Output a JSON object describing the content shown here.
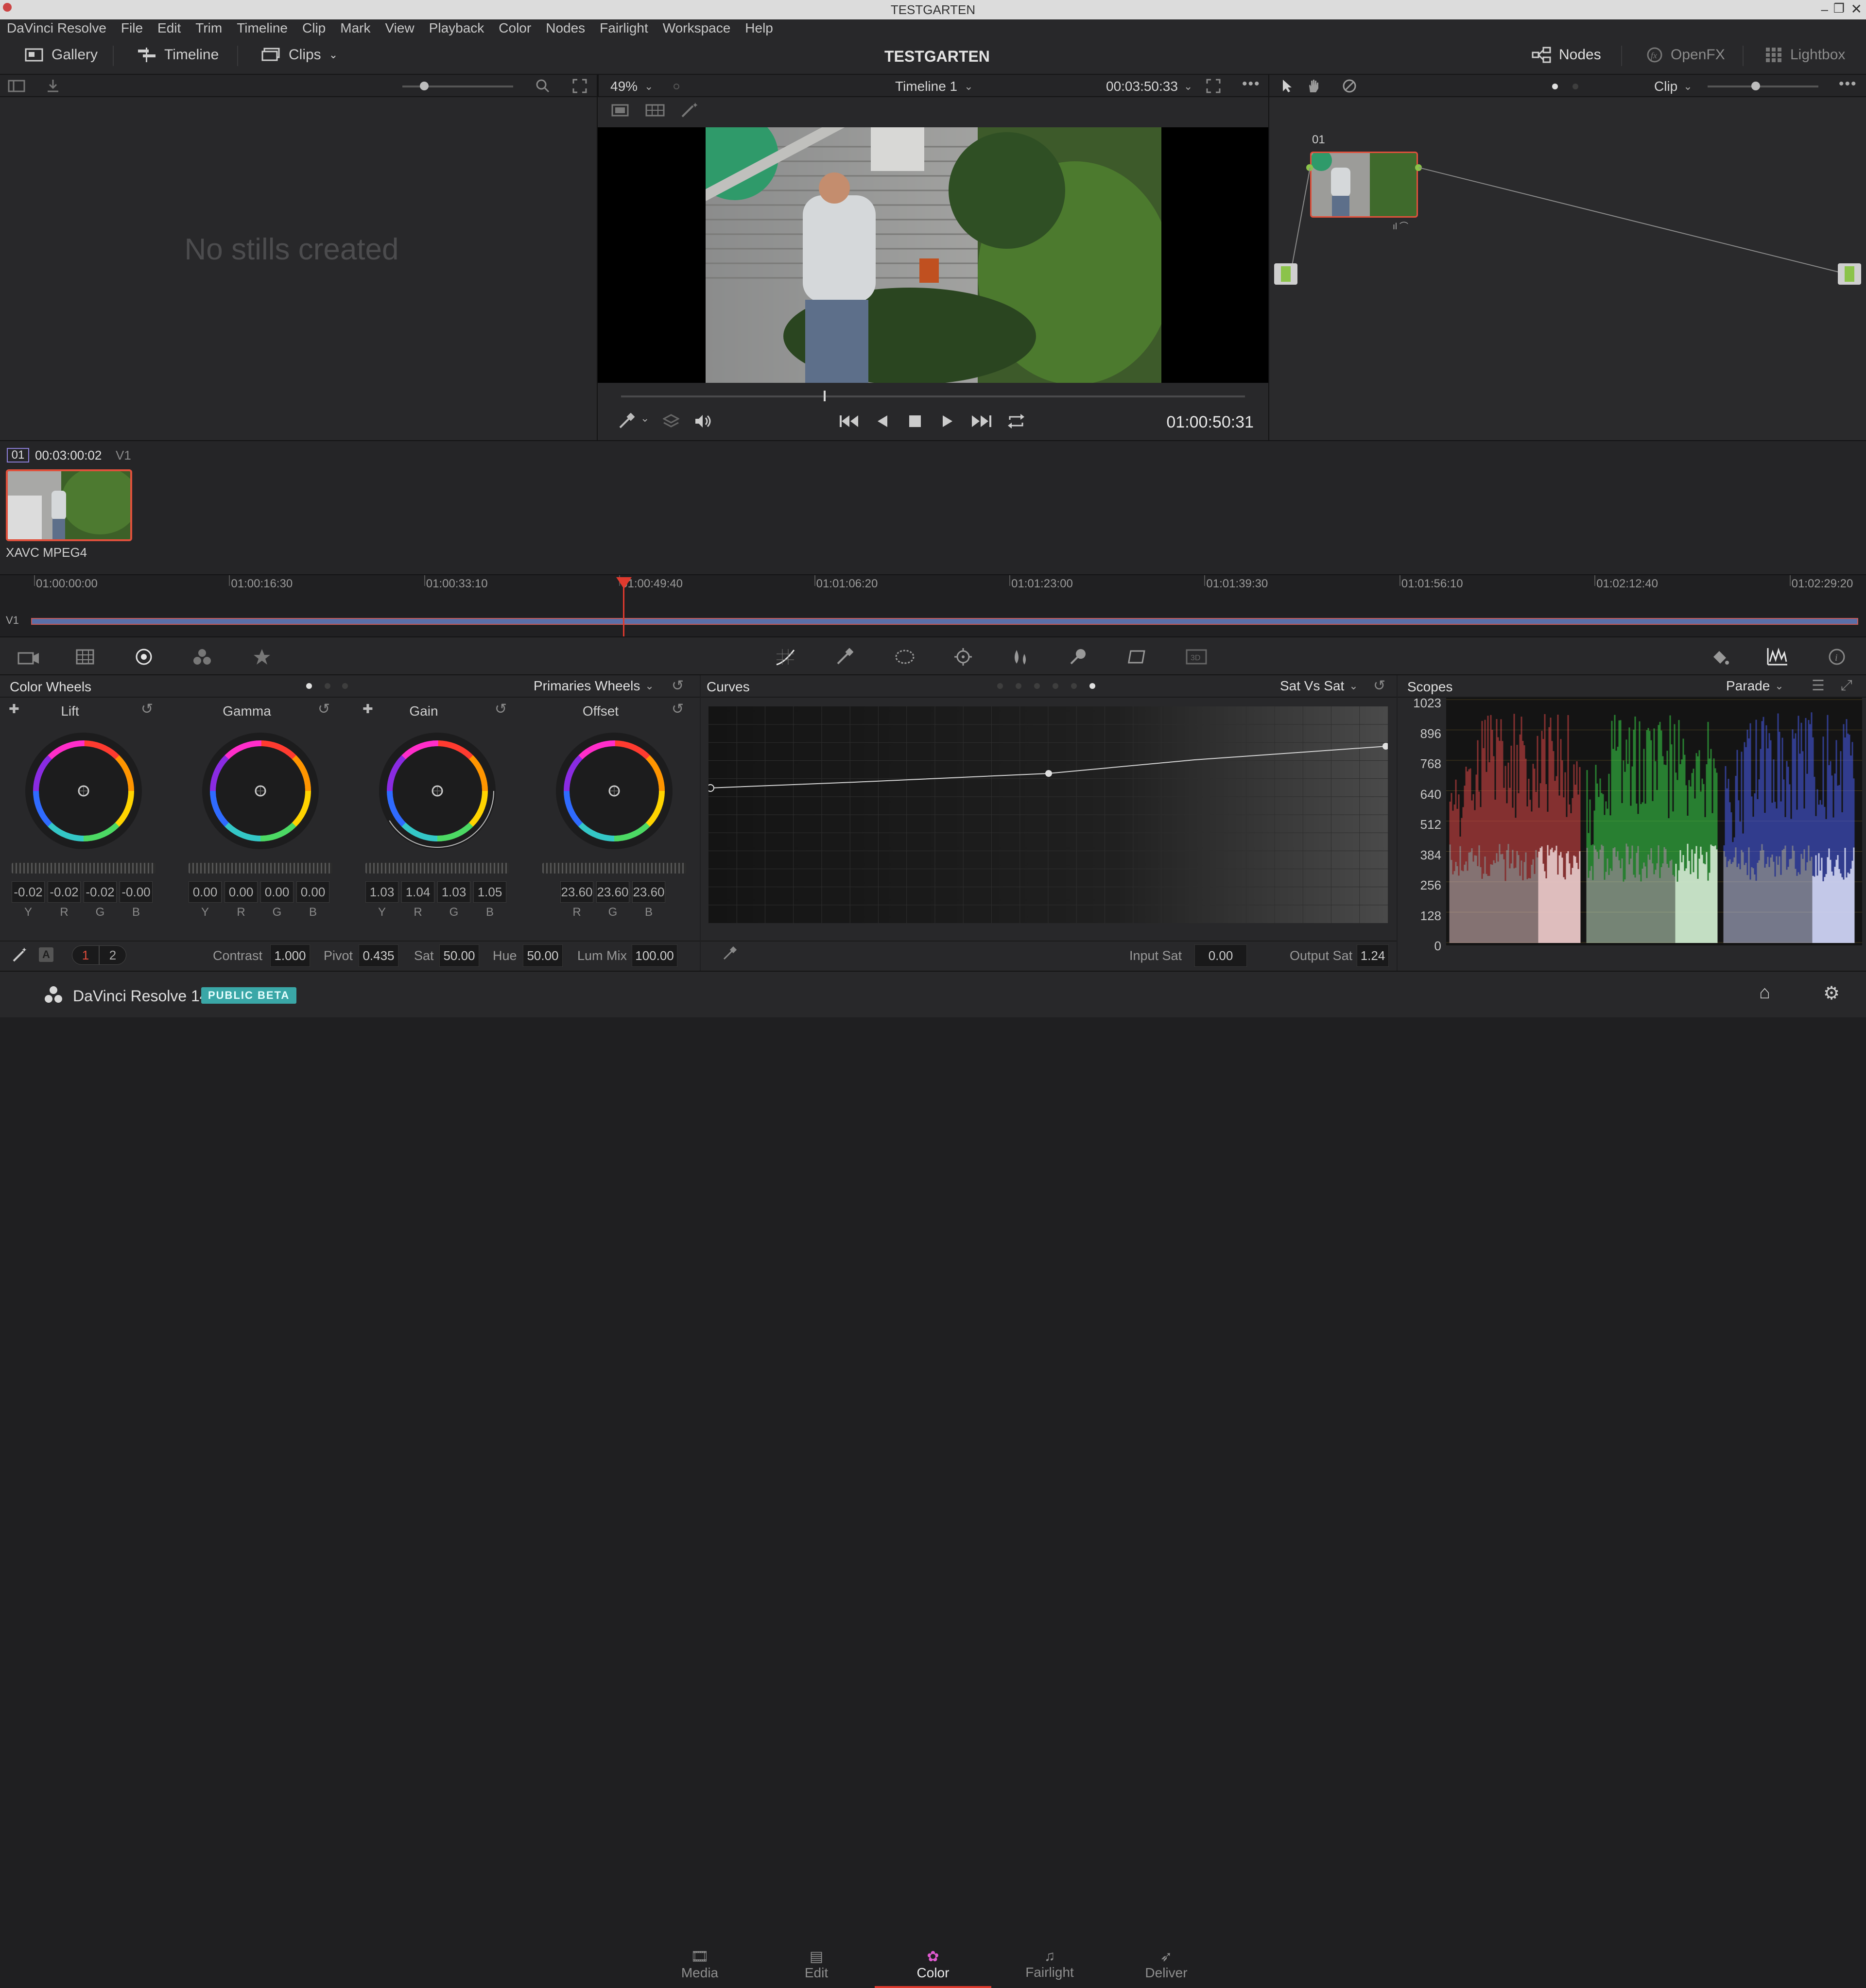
{
  "window": {
    "title": "TESTGARTEN"
  },
  "menu": [
    "DaVinci Resolve",
    "File",
    "Edit",
    "Trim",
    "Timeline",
    "Clip",
    "Mark",
    "View",
    "Playback",
    "Color",
    "Nodes",
    "Fairlight",
    "Workspace",
    "Help"
  ],
  "toolbar": {
    "gallery": "Gallery",
    "timeline": "Timeline",
    "clips": "Clips",
    "project": "TESTGARTEN",
    "nodes": "Nodes",
    "openfx": "OpenFX",
    "lightbox": "Lightbox"
  },
  "viewer": {
    "zoom": "49%",
    "timeline_name": "Timeline 1",
    "timecode_top": "00:03:50:33",
    "timecode": "01:00:50:31",
    "playhead_fraction": 0.325
  },
  "node_panel": {
    "mode": "Clip",
    "node_label": "01"
  },
  "gallery": {
    "empty_text": "No stills created"
  },
  "clip": {
    "index": "01",
    "timecode": "00:03:00:02",
    "track": "V1",
    "codec": "XAVC MPEG4"
  },
  "ruler": {
    "ticks": [
      "01:00:00:00",
      "01:00:16:30",
      "01:00:33:10",
      "01:00:49:40",
      "01:01:06:20",
      "01:01:23:00",
      "01:01:39:30",
      "01:01:56:10",
      "01:02:12:40",
      "01:02:29:20"
    ],
    "track": "V1"
  },
  "color_wheels": {
    "title": "Color Wheels",
    "mode": "Primaries Wheels",
    "wheels": [
      {
        "name": "Lift",
        "channels": [
          "Y",
          "R",
          "G",
          "B"
        ],
        "values": [
          "-0.02",
          "-0.02",
          "-0.02",
          "-0.00"
        ]
      },
      {
        "name": "Gamma",
        "channels": [
          "Y",
          "R",
          "G",
          "B"
        ],
        "values": [
          "0.00",
          "0.00",
          "0.00",
          "0.00"
        ]
      },
      {
        "name": "Gain",
        "channels": [
          "Y",
          "R",
          "G",
          "B"
        ],
        "values": [
          "1.03",
          "1.04",
          "1.03",
          "1.05"
        ]
      },
      {
        "name": "Offset",
        "channels": [
          "R",
          "G",
          "B"
        ],
        "values": [
          "23.60",
          "23.60",
          "23.60"
        ]
      }
    ],
    "page1": "1",
    "page2": "2",
    "contrast_label": "Contrast",
    "contrast": "1.000",
    "pivot_label": "Pivot",
    "pivot": "0.435",
    "sat_label": "Sat",
    "sat": "50.00",
    "hue_label": "Hue",
    "hue": "50.00",
    "lummix_label": "Lum Mix",
    "lummix": "100.00"
  },
  "curves": {
    "title": "Curves",
    "mode": "Sat Vs Sat",
    "input_sat_label": "Input Sat",
    "input_sat": "0.00",
    "output_sat_label": "Output Sat",
    "output_sat": "1.24"
  },
  "scopes": {
    "title": "Scopes",
    "mode": "Parade",
    "scale": [
      "1023",
      "896",
      "768",
      "640",
      "512",
      "384",
      "256",
      "128",
      "0"
    ]
  },
  "footer": {
    "app": "DaVinci Resolve 14",
    "badge": "PUBLIC BETA",
    "tabs": [
      "Media",
      "Edit",
      "Color",
      "Fairlight",
      "Deliver"
    ],
    "active_tab": "Color"
  },
  "colors": {
    "accent": "#e64b3c",
    "active_tab": "#e8e8e8",
    "clip_border": "#e0503c",
    "playhead": "#e03a2e"
  }
}
